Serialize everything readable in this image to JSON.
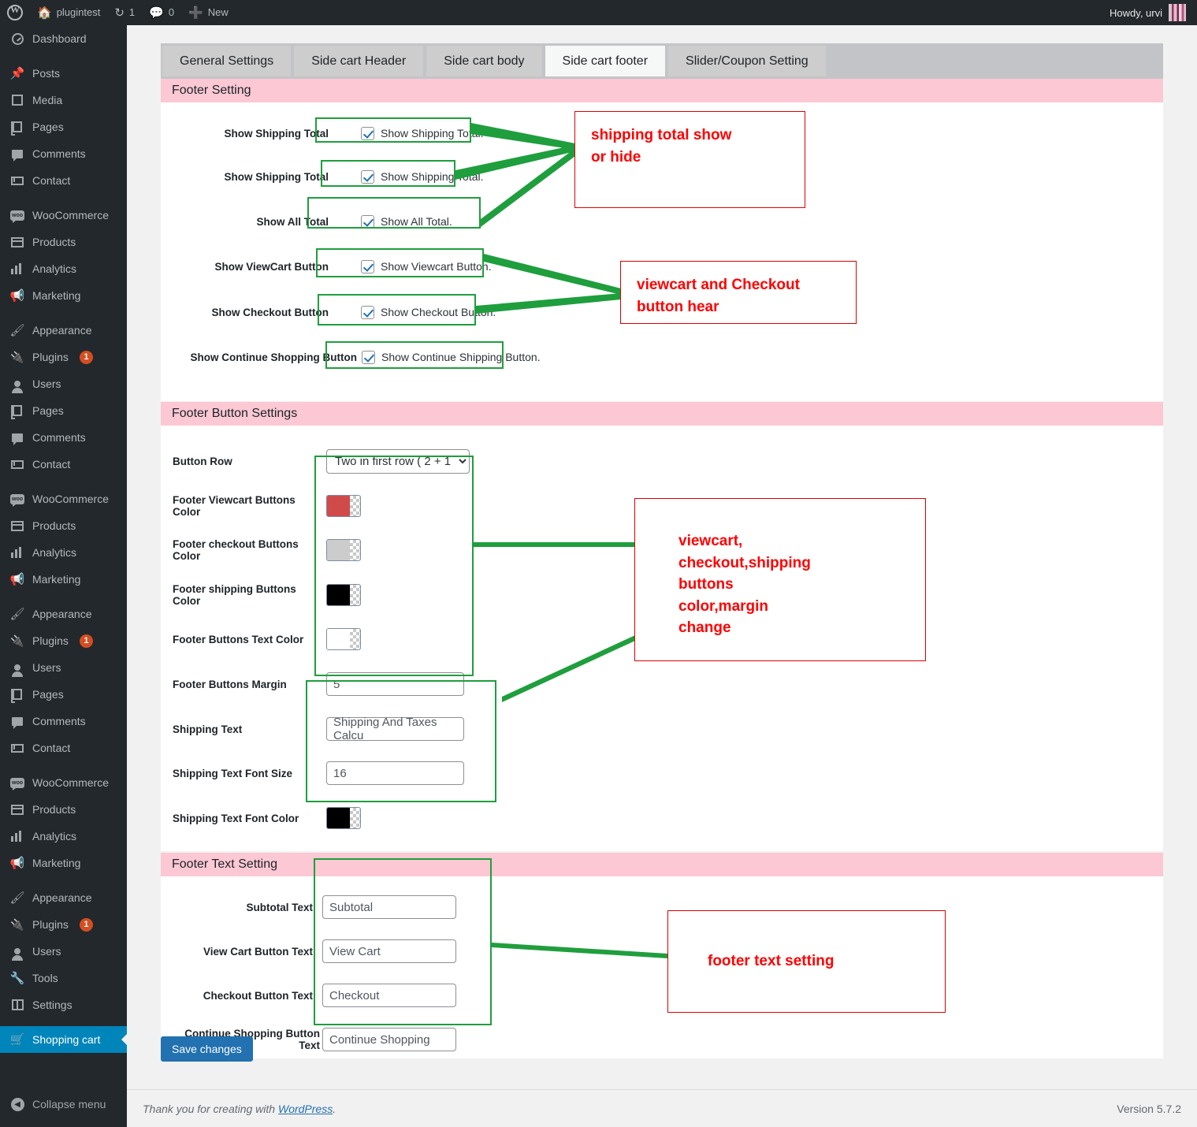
{
  "adminbar": {
    "site_name": "plugintest",
    "updates_count": "1",
    "comments_count": "0",
    "new_label": "New",
    "howdy": "Howdy, urvi",
    "icons": {
      "wp": "wordpress-logo-icon",
      "home": "home-icon",
      "updates": "updates-icon",
      "comments": "comment-icon",
      "new": "plus-icon",
      "avatar": "avatar"
    }
  },
  "sidebar": {
    "items": [
      {
        "label": "Dashboard",
        "icon": "dashboard-icon",
        "kind": "item"
      },
      {
        "kind": "sep"
      },
      {
        "label": "Posts",
        "icon": "pin-icon",
        "kind": "item"
      },
      {
        "label": "Media",
        "icon": "media-icon",
        "kind": "item"
      },
      {
        "label": "Pages",
        "icon": "pages-icon",
        "kind": "item"
      },
      {
        "label": "Comments",
        "icon": "comment-icon",
        "kind": "item"
      },
      {
        "label": "Contact",
        "icon": "mail-icon",
        "kind": "item"
      },
      {
        "kind": "sep"
      },
      {
        "label": "WooCommerce",
        "icon": "woocommerce-icon",
        "kind": "item"
      },
      {
        "label": "Products",
        "icon": "products-icon",
        "kind": "item"
      },
      {
        "label": "Analytics",
        "icon": "analytics-icon",
        "kind": "item"
      },
      {
        "label": "Marketing",
        "icon": "marketing-icon",
        "kind": "item"
      },
      {
        "kind": "sep"
      },
      {
        "label": "Appearance",
        "icon": "appearance-icon",
        "kind": "item"
      },
      {
        "label": "Plugins",
        "icon": "plugins-icon",
        "kind": "item",
        "badge": "1"
      },
      {
        "label": "Users",
        "icon": "users-icon",
        "kind": "item"
      },
      {
        "label": "Pages",
        "icon": "pages-icon",
        "kind": "item"
      },
      {
        "label": "Comments",
        "icon": "comment-icon",
        "kind": "item"
      },
      {
        "label": "Contact",
        "icon": "mail-icon",
        "kind": "item"
      },
      {
        "kind": "sep"
      },
      {
        "label": "WooCommerce",
        "icon": "woocommerce-icon",
        "kind": "item"
      },
      {
        "label": "Products",
        "icon": "products-icon",
        "kind": "item"
      },
      {
        "label": "Analytics",
        "icon": "analytics-icon",
        "kind": "item"
      },
      {
        "label": "Marketing",
        "icon": "marketing-icon",
        "kind": "item"
      },
      {
        "kind": "sep"
      },
      {
        "label": "Appearance",
        "icon": "appearance-icon",
        "kind": "item"
      },
      {
        "label": "Plugins",
        "icon": "plugins-icon",
        "kind": "item",
        "badge": "1"
      },
      {
        "label": "Users",
        "icon": "users-icon",
        "kind": "item"
      },
      {
        "label": "Pages",
        "icon": "pages-icon",
        "kind": "item"
      },
      {
        "label": "Comments",
        "icon": "comment-icon",
        "kind": "item"
      },
      {
        "label": "Contact",
        "icon": "mail-icon",
        "kind": "item"
      },
      {
        "kind": "sep"
      },
      {
        "label": "WooCommerce",
        "icon": "woocommerce-icon",
        "kind": "item"
      },
      {
        "label": "Products",
        "icon": "products-icon",
        "kind": "item"
      },
      {
        "label": "Analytics",
        "icon": "analytics-icon",
        "kind": "item"
      },
      {
        "label": "Marketing",
        "icon": "marketing-icon",
        "kind": "item"
      },
      {
        "kind": "sep"
      },
      {
        "label": "Appearance",
        "icon": "appearance-icon",
        "kind": "item"
      },
      {
        "label": "Plugins",
        "icon": "plugins-icon",
        "kind": "item",
        "badge": "1"
      },
      {
        "label": "Users",
        "icon": "users-icon",
        "kind": "item"
      },
      {
        "label": "Tools",
        "icon": "tools-icon",
        "kind": "item"
      },
      {
        "label": "Settings",
        "icon": "settings-icon",
        "kind": "item"
      },
      {
        "kind": "sep"
      },
      {
        "label": "Shopping cart",
        "icon": "cart-icon",
        "kind": "item",
        "active": true
      }
    ],
    "collapse_label": "Collapse menu"
  },
  "tabs": [
    {
      "label": "General Settings",
      "active": false
    },
    {
      "label": "Side cart Header",
      "active": false
    },
    {
      "label": "Side cart body",
      "active": false
    },
    {
      "label": "Side cart footer",
      "active": true
    },
    {
      "label": "Slider/Coupon Setting",
      "active": false
    }
  ],
  "footer_setting": {
    "heading": "Footer Setting",
    "rows": [
      {
        "label": "Show Shipping Total",
        "checkbox_label": "Show Shipping Total.",
        "checked": true
      },
      {
        "label": "Show Shipping Total",
        "checkbox_label": "Show Shipping Total.",
        "checked": true
      },
      {
        "label": "Show All Total",
        "checkbox_label": "Show All Total.",
        "checked": true
      },
      {
        "label": "Show ViewCart Button",
        "checkbox_label": "Show Viewcart Button.",
        "checked": true
      },
      {
        "label": "Show Checkout Button",
        "checkbox_label": "Show Checkout Button.",
        "checked": true
      },
      {
        "label": "Show Continue Shopping Button",
        "checkbox_label": "Show Continue Shipping Button.",
        "checked": true
      }
    ]
  },
  "footer_button_settings": {
    "heading": "Footer Button Settings",
    "button_row": {
      "label": "Button Row",
      "value": "Two in first row ( 2 + 1 )",
      "options": [
        "Two in first row ( 2 + 1 )"
      ]
    },
    "viewcart_color": {
      "label": "Footer Viewcart Buttons Color",
      "value": "#d14a4a"
    },
    "checkout_color": {
      "label": "Footer checkout Buttons Color",
      "value": "#cccccc"
    },
    "shipping_color": {
      "label": "Footer shipping Buttons Color",
      "value": "#000000"
    },
    "text_color": {
      "label": "Footer Buttons Text Color",
      "value": "#ffffff"
    },
    "margin": {
      "label": "Footer Buttons Margin",
      "value": "5"
    },
    "shipping_text": {
      "label": "Shipping Text",
      "value": "Shipping And Taxes Calcu"
    },
    "shipping_font_size": {
      "label": "Shipping Text Font Size",
      "value": "16"
    },
    "shipping_font_color": {
      "label": "Shipping Text Font Color",
      "value": "#000000"
    }
  },
  "footer_text_setting": {
    "heading": "Footer Text Setting",
    "rows": [
      {
        "label": "Subtotal Text",
        "value": "Subtotal"
      },
      {
        "label": "View Cart Button Text",
        "value": "View Cart"
      },
      {
        "label": "Checkout Button Text",
        "value": "Checkout"
      },
      {
        "label": "Continue Shopping Button Text",
        "value": "Continue Shopping"
      }
    ]
  },
  "save_label": "Save changes",
  "page_footer": {
    "thanks_prefix": "Thank you for creating with ",
    "wordpress_link": "WordPress",
    "thanks_suffix": ".",
    "version": "Version 5.7.2"
  },
  "annotations": [
    {
      "id": "a1",
      "lines": [
        "shipping total show",
        "or hide"
      ]
    },
    {
      "id": "a2",
      "lines": [
        "viewcart and Checkout",
        "button hear"
      ]
    },
    {
      "id": "a3",
      "lines": [
        "viewcart,",
        "checkout,shipping",
        "buttons",
        "color,margin",
        "change"
      ]
    },
    {
      "id": "a4",
      "lines": [
        "footer text setting"
      ]
    }
  ],
  "colors": {
    "annotation_box": "#1f9e3d",
    "annotation_text": "#ff0000",
    "accent": "#2271b1",
    "section_header": "#fbc8d4"
  }
}
